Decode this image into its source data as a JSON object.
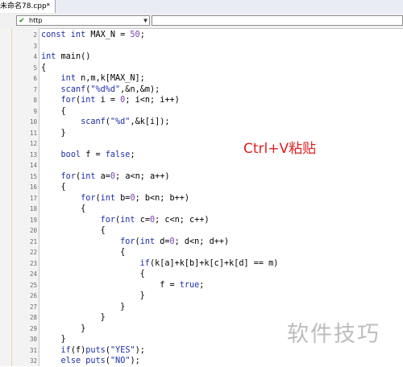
{
  "tab": {
    "title": "未命名78.cpp*"
  },
  "toolbar": {
    "combo1_value": "http",
    "combo2_value": ""
  },
  "editor": {
    "lines": [
      {
        "n": "2",
        "tokens": [
          {
            "t": "kw",
            "v": "const int"
          },
          {
            "t": "p",
            "v": " MAX_N = "
          },
          {
            "t": "num",
            "v": "50"
          },
          {
            "t": "p",
            "v": ";"
          }
        ]
      },
      {
        "n": "3",
        "tokens": []
      },
      {
        "n": "4",
        "tokens": [
          {
            "t": "kw",
            "v": "int"
          },
          {
            "t": "p",
            "v": " main()"
          }
        ]
      },
      {
        "n": "5",
        "tokens": [
          {
            "t": "p",
            "v": "{"
          }
        ]
      },
      {
        "n": "6",
        "tokens": [
          {
            "t": "p",
            "v": "    "
          },
          {
            "t": "kw",
            "v": "int"
          },
          {
            "t": "p",
            "v": " n,m,k[MAX_N];"
          }
        ]
      },
      {
        "n": "7",
        "tokens": [
          {
            "t": "p",
            "v": "    "
          },
          {
            "t": "kw",
            "v": "scanf"
          },
          {
            "t": "p",
            "v": "("
          },
          {
            "t": "str",
            "v": "\"%d%d\""
          },
          {
            "t": "p",
            "v": ",&n,&m);"
          }
        ]
      },
      {
        "n": "8",
        "tokens": [
          {
            "t": "p",
            "v": "    "
          },
          {
            "t": "kw",
            "v": "for"
          },
          {
            "t": "p",
            "v": "("
          },
          {
            "t": "kw",
            "v": "int"
          },
          {
            "t": "p",
            "v": " i = "
          },
          {
            "t": "num",
            "v": "0"
          },
          {
            "t": "p",
            "v": "; i<n; i++)"
          }
        ]
      },
      {
        "n": "9",
        "tokens": [
          {
            "t": "p",
            "v": "    {"
          }
        ]
      },
      {
        "n": "10",
        "tokens": [
          {
            "t": "p",
            "v": "        "
          },
          {
            "t": "kw",
            "v": "scanf"
          },
          {
            "t": "p",
            "v": "("
          },
          {
            "t": "str",
            "v": "\"%d\""
          },
          {
            "t": "p",
            "v": ",&k[i]);"
          }
        ]
      },
      {
        "n": "11",
        "tokens": [
          {
            "t": "p",
            "v": "    }"
          }
        ]
      },
      {
        "n": "12",
        "tokens": []
      },
      {
        "n": "13",
        "tokens": [
          {
            "t": "p",
            "v": "    "
          },
          {
            "t": "kw",
            "v": "bool"
          },
          {
            "t": "p",
            "v": " f = "
          },
          {
            "t": "kw",
            "v": "false"
          },
          {
            "t": "p",
            "v": ";"
          }
        ]
      },
      {
        "n": "14",
        "tokens": []
      },
      {
        "n": "15",
        "tokens": [
          {
            "t": "p",
            "v": "    "
          },
          {
            "t": "kw",
            "v": "for"
          },
          {
            "t": "p",
            "v": "("
          },
          {
            "t": "kw",
            "v": "int"
          },
          {
            "t": "p",
            "v": " a="
          },
          {
            "t": "num",
            "v": "0"
          },
          {
            "t": "p",
            "v": "; a<n; a++)"
          }
        ]
      },
      {
        "n": "16",
        "tokens": [
          {
            "t": "p",
            "v": "    {"
          }
        ]
      },
      {
        "n": "17",
        "tokens": [
          {
            "t": "p",
            "v": "        "
          },
          {
            "t": "kw",
            "v": "for"
          },
          {
            "t": "p",
            "v": "("
          },
          {
            "t": "kw",
            "v": "int"
          },
          {
            "t": "p",
            "v": " b="
          },
          {
            "t": "num",
            "v": "0"
          },
          {
            "t": "p",
            "v": "; b<n; b++)"
          }
        ]
      },
      {
        "n": "18",
        "tokens": [
          {
            "t": "p",
            "v": "        {"
          }
        ]
      },
      {
        "n": "19",
        "tokens": [
          {
            "t": "p",
            "v": "            "
          },
          {
            "t": "kw",
            "v": "for"
          },
          {
            "t": "p",
            "v": "("
          },
          {
            "t": "kw",
            "v": "int"
          },
          {
            "t": "p",
            "v": " c="
          },
          {
            "t": "num",
            "v": "0"
          },
          {
            "t": "p",
            "v": "; c<n; c++)"
          }
        ]
      },
      {
        "n": "20",
        "tokens": [
          {
            "t": "p",
            "v": "            {"
          }
        ]
      },
      {
        "n": "21",
        "tokens": [
          {
            "t": "p",
            "v": "                "
          },
          {
            "t": "kw",
            "v": "for"
          },
          {
            "t": "p",
            "v": "("
          },
          {
            "t": "kw",
            "v": "int"
          },
          {
            "t": "p",
            "v": " d="
          },
          {
            "t": "num",
            "v": "0"
          },
          {
            "t": "p",
            "v": "; d<n; d++)"
          }
        ]
      },
      {
        "n": "22",
        "tokens": [
          {
            "t": "p",
            "v": "                {"
          }
        ]
      },
      {
        "n": "23",
        "tokens": [
          {
            "t": "p",
            "v": "                    "
          },
          {
            "t": "kw",
            "v": "if"
          },
          {
            "t": "p",
            "v": "(k[a]+k[b]+k[c]+k[d] == m)"
          }
        ]
      },
      {
        "n": "24",
        "tokens": [
          {
            "t": "p",
            "v": "                    {"
          }
        ]
      },
      {
        "n": "25",
        "tokens": [
          {
            "t": "p",
            "v": "                        f = "
          },
          {
            "t": "kw",
            "v": "true"
          },
          {
            "t": "p",
            "v": ";"
          }
        ]
      },
      {
        "n": "26",
        "tokens": [
          {
            "t": "p",
            "v": "                    }"
          }
        ]
      },
      {
        "n": "27",
        "tokens": [
          {
            "t": "p",
            "v": "                }"
          }
        ]
      },
      {
        "n": "28",
        "tokens": [
          {
            "t": "p",
            "v": "            }"
          }
        ]
      },
      {
        "n": "29",
        "tokens": [
          {
            "t": "p",
            "v": "        }"
          }
        ]
      },
      {
        "n": "30",
        "tokens": [
          {
            "t": "p",
            "v": "    }"
          }
        ]
      },
      {
        "n": "31",
        "tokens": [
          {
            "t": "p",
            "v": "    "
          },
          {
            "t": "kw",
            "v": "if"
          },
          {
            "t": "p",
            "v": "(f)"
          },
          {
            "t": "kw",
            "v": "puts"
          },
          {
            "t": "p",
            "v": "("
          },
          {
            "t": "str",
            "v": "\"YES\""
          },
          {
            "t": "p",
            "v": ");"
          }
        ]
      },
      {
        "n": "32",
        "tokens": [
          {
            "t": "p",
            "v": "    "
          },
          {
            "t": "kw",
            "v": "else"
          },
          {
            "t": "p",
            "v": " "
          },
          {
            "t": "kw",
            "v": "puts"
          },
          {
            "t": "p",
            "v": "("
          },
          {
            "t": "str",
            "v": "\"NO\""
          },
          {
            "t": "p",
            "v": ");"
          }
        ]
      }
    ]
  },
  "overlay": {
    "text": "Ctrl+V粘贴"
  },
  "watermark": {
    "text": "软件技巧"
  },
  "colors": {
    "keyword": "#1c2ea8",
    "number": "#7a3fb8",
    "overlay": "#e02020"
  }
}
